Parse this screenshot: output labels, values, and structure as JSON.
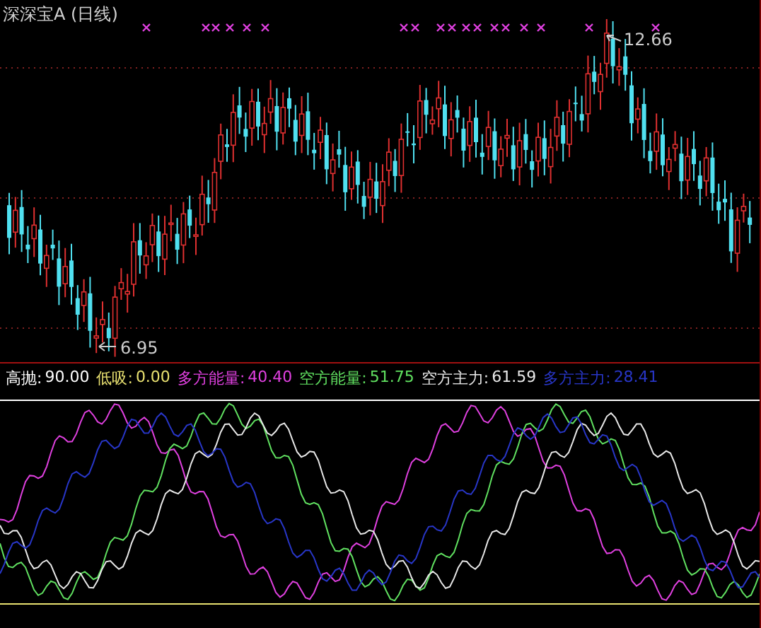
{
  "price_panel": {
    "title": "深深宝A (日线)",
    "high_label": "12.66",
    "low_label": "6.95"
  },
  "indicator": {
    "readings": [
      {
        "label": "高抛:",
        "value": "90.00",
        "color": "#ffffff",
        "kind": "threshold"
      },
      {
        "label": "低吸:",
        "value": "0.00",
        "color": "#e8e070",
        "kind": "threshold"
      },
      {
        "label": "多方能量:",
        "value": "40.40",
        "color": "#e040e0",
        "kind": "curve"
      },
      {
        "label": "空方能量:",
        "value": "51.75",
        "color": "#60e060",
        "kind": "curve"
      },
      {
        "label": "空方主力:",
        "value": "61.59",
        "color": "#e8e8e8",
        "kind": "curve"
      },
      {
        "label": "多方主力:",
        "value": "28.41",
        "color": "#2836c8",
        "kind": "curve"
      }
    ]
  }
}
